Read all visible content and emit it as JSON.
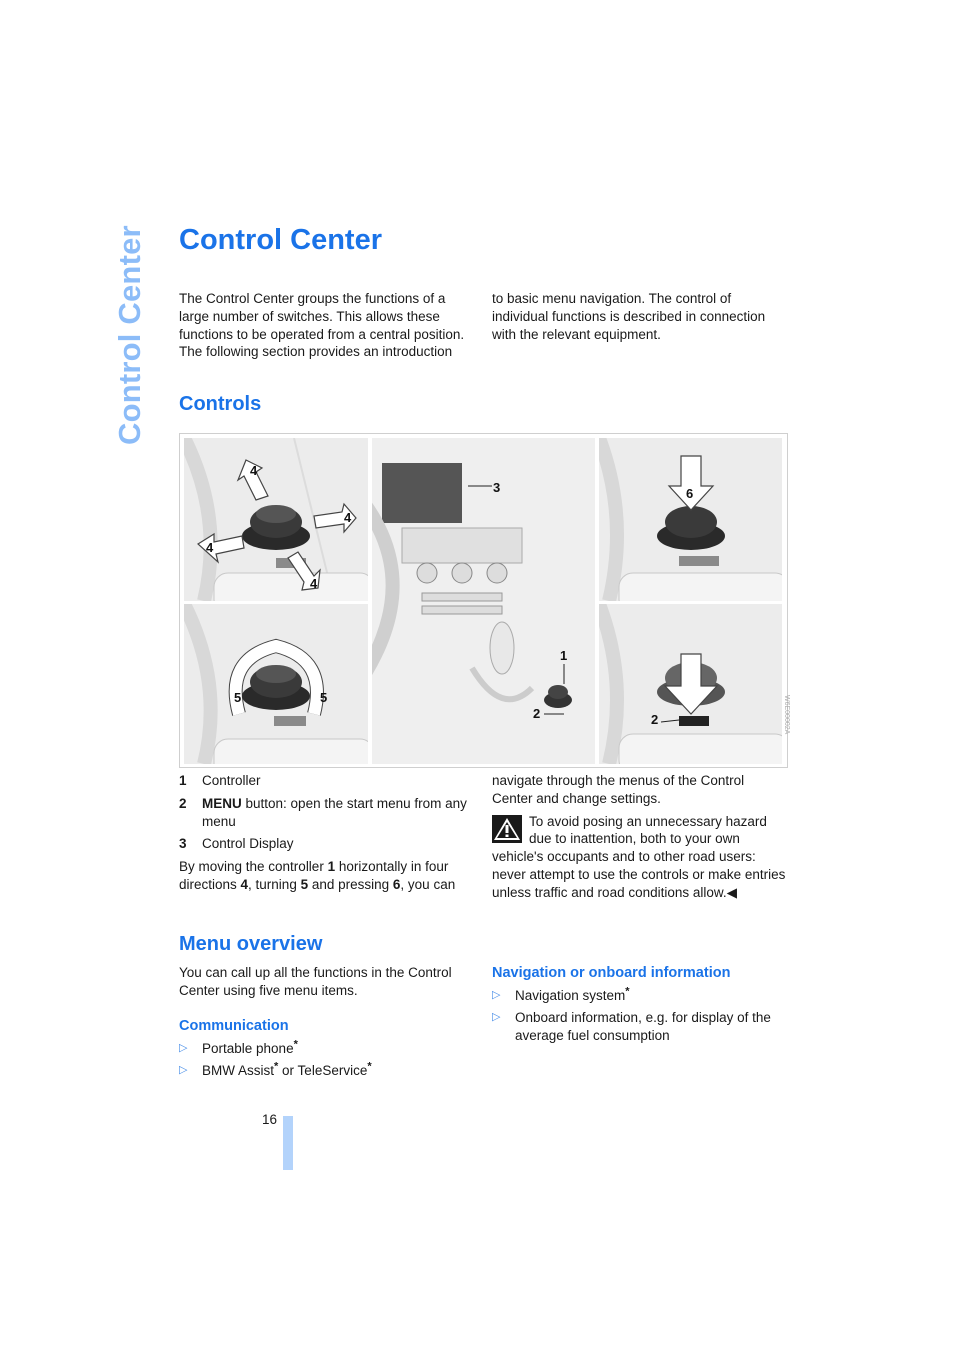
{
  "side_tab": "Control Center",
  "title": "Control Center",
  "intro": {
    "col1": "The Control Center groups the functions of a large number of switches. This allows these functions to be operated from a central position. The following section provides an introduction",
    "col2": "to basic menu navigation. The control of individual functions is described in connection with the relevant equipment."
  },
  "controls": {
    "heading": "Controls",
    "figure": {
      "callouts": [
        "1",
        "2",
        "3",
        "4",
        "5",
        "6"
      ],
      "panel_labels": {
        "move": "4",
        "turn": "5",
        "press": "6",
        "controller": "1",
        "menu_button": "2",
        "display": "3"
      },
      "image_code": "W6E00002A"
    },
    "legend": [
      {
        "num": "1",
        "label": "Controller",
        "bold_prefix": ""
      },
      {
        "num": "2",
        "label": "button: open the start menu from any menu",
        "bold_prefix": "MENU"
      },
      {
        "num": "3",
        "label": "Control Display",
        "bold_prefix": ""
      }
    ],
    "body_left": {
      "t1": "By moving the controller ",
      "b1": "1",
      "t2": " horizontally in four directions ",
      "b2": "4",
      "t3": ", turning ",
      "b3": "5",
      "t4": " and pressing ",
      "b4": "6",
      "t5": ", you can"
    },
    "body_right": "navigate through the menus of the Control Center and change settings.",
    "warning": "To avoid posing an unnecessary hazard due to inattention, both to your own vehicle's occupants and to other road users: never attempt to use the controls or make entries unless traffic and road conditions allow.",
    "end_mark": "◀"
  },
  "menu_overview": {
    "heading": "Menu overview",
    "intro": "You can call up all the functions in the Control Center using five menu items.",
    "sections": [
      {
        "heading": "Communication",
        "items": [
          {
            "text": "Portable phone",
            "star": "*",
            "text2": "",
            "star2": ""
          },
          {
            "text": "BMW Assist",
            "star": "*",
            "text2": " or TeleService",
            "star2": "*"
          }
        ]
      },
      {
        "heading": "Navigation or onboard information",
        "items": [
          {
            "text": "Navigation system",
            "star": "*",
            "text2": "",
            "star2": ""
          },
          {
            "text": "Onboard information, e.g. for display of the average fuel consumption",
            "star": "",
            "text2": "",
            "star2": ""
          }
        ]
      }
    ],
    "bullet_glyph": "▷"
  },
  "page_number": "16",
  "colors": {
    "heading_blue": "#1a73e8",
    "side_tab_blue": "#8cbcf8",
    "page_bar": "#b3d3fb"
  }
}
